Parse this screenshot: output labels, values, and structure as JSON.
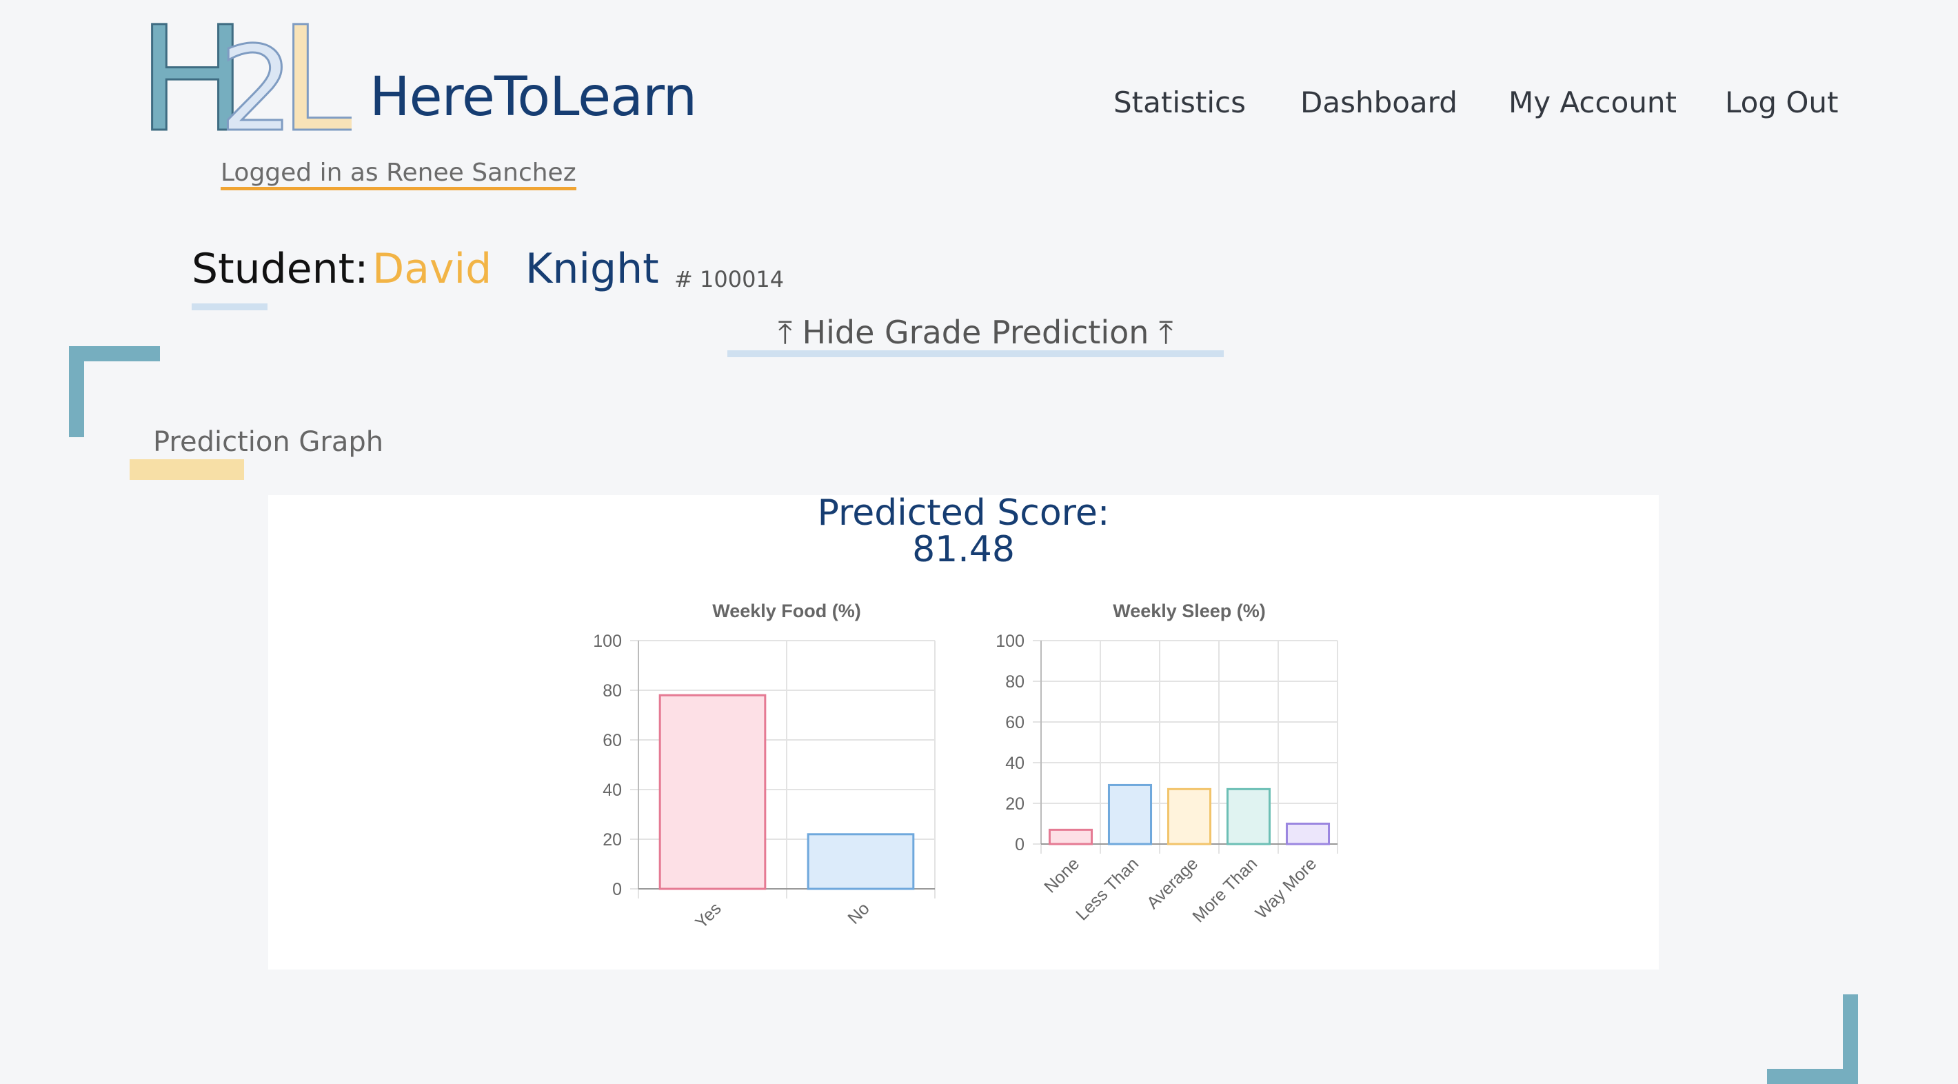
{
  "brand": {
    "logo_letters": [
      "H",
      "2",
      "L"
    ],
    "name": "HereToLearn"
  },
  "nav": {
    "items": [
      "Statistics",
      "Dashboard",
      "My Account",
      "Log Out"
    ]
  },
  "session": {
    "logged_in_text": "Logged in as Renee Sanchez"
  },
  "student": {
    "label": "Student:",
    "first_name": "David",
    "last_name": "Knight",
    "id": "# 100014"
  },
  "prediction_toggle": {
    "label": "⤒ Hide Grade Prediction ⤒"
  },
  "prediction_section": {
    "title": "Prediction Graph",
    "score_label": "Predicted Score:",
    "score_value": "81.48"
  },
  "colors": {
    "brand_blue": "#163d72",
    "accent_yellow": "#f2b446",
    "accent_orange": "#f0a433",
    "frame_teal": "#76aebf",
    "underline_blue": "#cfe0f0",
    "underline_yellow": "#f7dfa6"
  },
  "chart_data": [
    {
      "type": "bar",
      "title": "Weekly Food (%)",
      "categories": [
        "Yes",
        "No"
      ],
      "values": [
        78,
        22
      ],
      "ylim": [
        0,
        100
      ],
      "yticks": [
        0,
        20,
        40,
        60,
        80,
        100
      ],
      "grid": true,
      "colors": [
        {
          "fill": "#fde0e6",
          "stroke": "#e57a93"
        },
        {
          "fill": "#dcebfa",
          "stroke": "#6fa8dc"
        }
      ]
    },
    {
      "type": "bar",
      "title": "Weekly Sleep (%)",
      "categories": [
        "None",
        "Less Than",
        "Average",
        "More Than",
        "Way More"
      ],
      "values": [
        7,
        29,
        27,
        27,
        10
      ],
      "ylim": [
        0,
        100
      ],
      "yticks": [
        0,
        20,
        40,
        60,
        80,
        100
      ],
      "grid": true,
      "colors": [
        {
          "fill": "#fde0e6",
          "stroke": "#e57a93"
        },
        {
          "fill": "#dcebfa",
          "stroke": "#6fa8dc"
        },
        {
          "fill": "#fff3dc",
          "stroke": "#f2c46b"
        },
        {
          "fill": "#e0f3f1",
          "stroke": "#6cbfb5"
        },
        {
          "fill": "#ece6fb",
          "stroke": "#9b86e0"
        }
      ]
    }
  ]
}
